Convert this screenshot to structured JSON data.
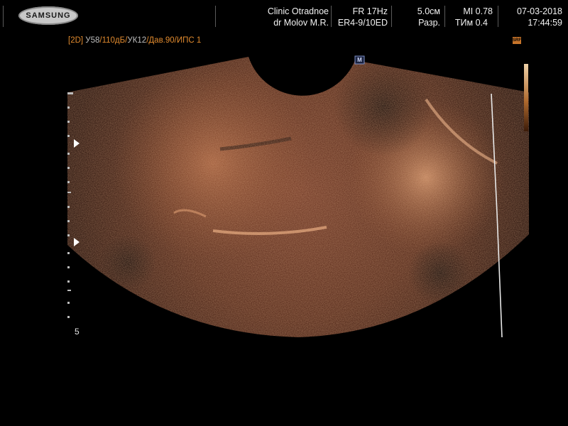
{
  "header": {
    "brand": "SAMSUNG",
    "clinic": "Clinic  Otradnoe",
    "doctor": "dr Molov M.R.",
    "frame_rate": "FR 17Hz",
    "probe": "ER4-9/10ED",
    "depth": "5.0см",
    "resolution": "Разр.",
    "mi": "MI  0.78",
    "tim": "TИм 0.4",
    "date": "07-03-2018",
    "time": "17:44:59"
  },
  "params": {
    "mode": "[2D]",
    "gain": "У58",
    "dynamic_range": "/110дБ/",
    "frame_avg": "УК12",
    "power": "/Дав.90/",
    "ips": "ИПС 1"
  },
  "srf_label": "SRF",
  "marker": "M",
  "depth_scale_label": "5",
  "colors": {
    "background": "#000000",
    "tint_dark": "#2a120a",
    "tint_mid": "#7a3a1e",
    "tint_bright": "#d9a070",
    "accent_orange": "#e08a2e"
  }
}
